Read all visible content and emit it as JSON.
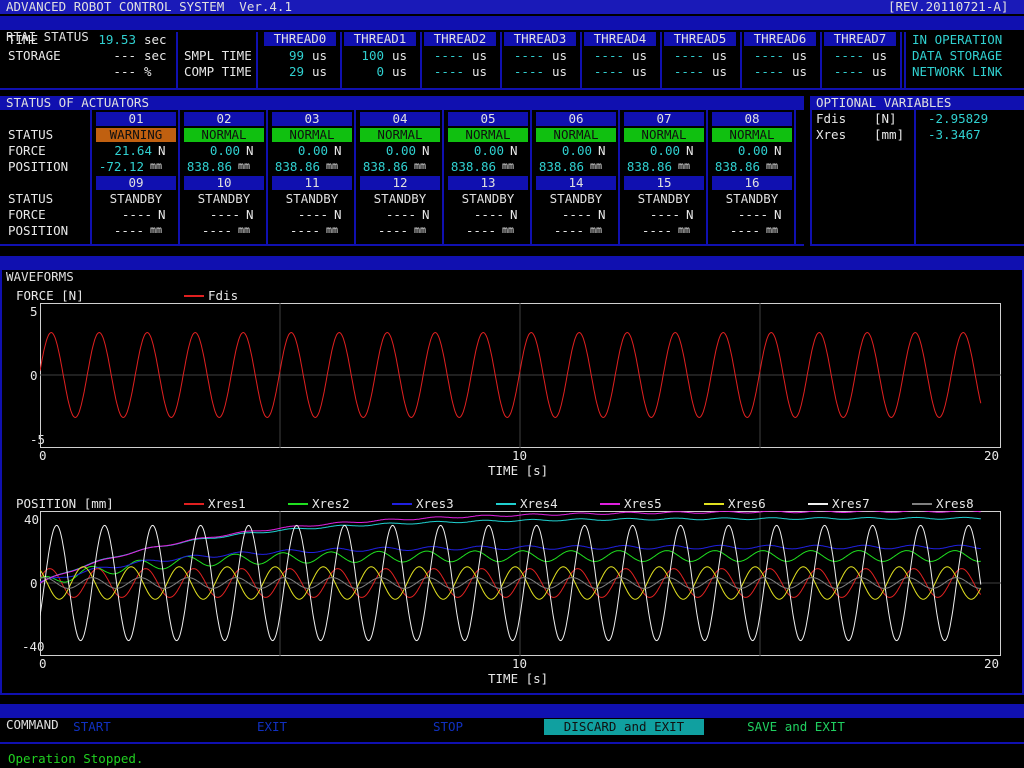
{
  "title_bar": {
    "title": "ADVANCED ROBOT CONTROL SYSTEM  Ver.4.1",
    "revision": "[REV.20110721-A]"
  },
  "rtai": {
    "section_title": "RTAI STATUS",
    "time_label": "TIME",
    "time_value": "19.53",
    "time_unit": "sec",
    "storage_label": "STORAGE",
    "storage_value1": "---",
    "storage_unit1": "sec",
    "storage_value2": "---",
    "storage_unit2": "%",
    "smpl_label": "SMPL TIME",
    "comp_label": "COMP TIME",
    "threads": [
      {
        "name": "THREAD0",
        "smpl": "99",
        "smpl_unit": "us",
        "comp": "29",
        "comp_unit": "us"
      },
      {
        "name": "THREAD1",
        "smpl": "100",
        "smpl_unit": "us",
        "comp": "0",
        "comp_unit": "us"
      },
      {
        "name": "THREAD2",
        "smpl": "----",
        "smpl_unit": "us",
        "comp": "----",
        "comp_unit": "us"
      },
      {
        "name": "THREAD3",
        "smpl": "----",
        "smpl_unit": "us",
        "comp": "----",
        "comp_unit": "us"
      },
      {
        "name": "THREAD4",
        "smpl": "----",
        "smpl_unit": "us",
        "comp": "----",
        "comp_unit": "us"
      },
      {
        "name": "THREAD5",
        "smpl": "----",
        "smpl_unit": "us",
        "comp": "----",
        "comp_unit": "us"
      },
      {
        "name": "THREAD6",
        "smpl": "----",
        "smpl_unit": "us",
        "comp": "----",
        "comp_unit": "us"
      },
      {
        "name": "THREAD7",
        "smpl": "----",
        "smpl_unit": "us",
        "comp": "----",
        "comp_unit": "us"
      }
    ],
    "indicators": [
      "IN OPERATION",
      "DATA STORAGE",
      "NETWORK LINK"
    ]
  },
  "actuators": {
    "section_title": "STATUS OF ACTUATORS",
    "row_labels": [
      "STATUS",
      "FORCE",
      "POSITION"
    ],
    "group1": [
      {
        "id": "01",
        "status": "WARNING",
        "force": "21.64",
        "position": "-72.12"
      },
      {
        "id": "02",
        "status": "NORMAL",
        "force": "0.00",
        "position": "838.86"
      },
      {
        "id": "03",
        "status": "NORMAL",
        "force": "0.00",
        "position": "838.86"
      },
      {
        "id": "04",
        "status": "NORMAL",
        "force": "0.00",
        "position": "838.86"
      },
      {
        "id": "05",
        "status": "NORMAL",
        "force": "0.00",
        "position": "838.86"
      },
      {
        "id": "06",
        "status": "NORMAL",
        "force": "0.00",
        "position": "838.86"
      },
      {
        "id": "07",
        "status": "NORMAL",
        "force": "0.00",
        "position": "838.86"
      },
      {
        "id": "08",
        "status": "NORMAL",
        "force": "0.00",
        "position": "838.86"
      }
    ],
    "group2": [
      {
        "id": "09",
        "status": "STANDBY",
        "force": "----",
        "position": "----"
      },
      {
        "id": "10",
        "status": "STANDBY",
        "force": "----",
        "position": "----"
      },
      {
        "id": "11",
        "status": "STANDBY",
        "force": "----",
        "position": "----"
      },
      {
        "id": "12",
        "status": "STANDBY",
        "force": "----",
        "position": "----"
      },
      {
        "id": "13",
        "status": "STANDBY",
        "force": "----",
        "position": "----"
      },
      {
        "id": "14",
        "status": "STANDBY",
        "force": "----",
        "position": "----"
      },
      {
        "id": "15",
        "status": "STANDBY",
        "force": "----",
        "position": "----"
      },
      {
        "id": "16",
        "status": "STANDBY",
        "force": "----",
        "position": "----"
      }
    ],
    "force_unit": "N",
    "position_unit": "mm",
    "status_colors": {
      "WARNING": "#c06010",
      "NORMAL": "#10c010"
    }
  },
  "optional": {
    "section_title": "OPTIONAL VARIABLES",
    "vars": [
      {
        "name": "Fdis",
        "unit": "[N]",
        "value": "-2.95829"
      },
      {
        "name": "Xres",
        "unit": "[mm]",
        "value": "-3.3467"
      }
    ]
  },
  "waveforms": {
    "section_title": "WAVEFORMS"
  },
  "chart_data": [
    {
      "type": "line",
      "title": "FORCE [N]",
      "xlabel": "TIME [s]",
      "xlim": [
        0,
        20
      ],
      "ylim": [
        -5,
        5
      ],
      "xticks": [
        "0",
        "10",
        "20"
      ],
      "yticks": [
        "5",
        "0",
        "-5"
      ],
      "series": [
        {
          "name": "Fdis",
          "color": "#e02020",
          "amplitude": 2.95,
          "period": 1.0,
          "phase": 0.1,
          "offset": 0,
          "tau": 0
        }
      ]
    },
    {
      "type": "line",
      "title": "POSITION [mm]",
      "xlabel": "TIME [s]",
      "xlim": [
        0,
        20
      ],
      "ylim": [
        -40,
        40
      ],
      "xticks": [
        "0",
        "10",
        "20"
      ],
      "yticks": [
        "40",
        "0",
        "-40"
      ],
      "series": [
        {
          "name": "Xres1",
          "color": "#e02020",
          "amplitude": 8,
          "period": 1.0,
          "phase": 0.3,
          "offset": 0,
          "tau": 0
        },
        {
          "name": "Xres2",
          "color": "#20e020",
          "amplitude": 3,
          "period": 1.0,
          "phase": 1.2,
          "offset": 15,
          "tau": 2
        },
        {
          "name": "Xres3",
          "color": "#2020e0",
          "amplitude": 1,
          "period": 1.0,
          "phase": 0.5,
          "offset": 20,
          "tau": 2.5
        },
        {
          "name": "Xres4",
          "color": "#20d0d0",
          "amplitude": 0.5,
          "period": 1.0,
          "phase": 0,
          "offset": 36,
          "tau": 3
        },
        {
          "name": "Xres5",
          "color": "#e020e0",
          "amplitude": 0.5,
          "period": 1.0,
          "phase": 0,
          "offset": 40,
          "tau": 3.5
        },
        {
          "name": "Xres6",
          "color": "#e0e020",
          "amplitude": 9,
          "period": 1.0,
          "phase": 2.2,
          "offset": 0,
          "tau": 0
        },
        {
          "name": "Xres7",
          "color": "#f0f0f0",
          "amplitude": 32,
          "period": 1.0,
          "phase": -0.6,
          "offset": 0,
          "tau": 0
        },
        {
          "name": "Xres8",
          "color": "#808080",
          "amplitude": 3,
          "period": 1.0,
          "phase": 1.0,
          "offset": 0,
          "tau": 0
        }
      ]
    }
  ],
  "command": {
    "section_title": "COMMAND",
    "buttons": [
      {
        "label": "START",
        "state": "disabled"
      },
      {
        "label": "EXIT",
        "state": "disabled"
      },
      {
        "label": "STOP",
        "state": "disabled"
      },
      {
        "label": "DISCARD and EXIT",
        "state": "selected"
      },
      {
        "label": "SAVE and EXIT",
        "state": "enabled"
      }
    ]
  },
  "status_message": "Operation Stopped."
}
